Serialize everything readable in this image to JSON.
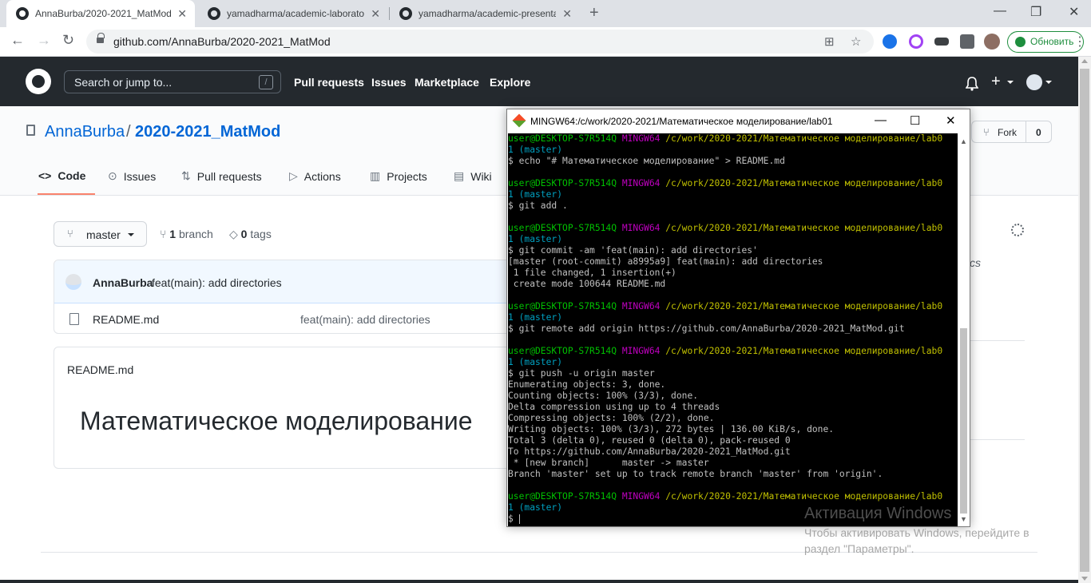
{
  "browser": {
    "tabs": [
      {
        "label": "AnnaBurba/2020-2021_MatMod",
        "active": true
      },
      {
        "label": "yamadharma/academic-laborato",
        "active": false
      },
      {
        "label": "yamadharma/academic-presenta",
        "active": false
      }
    ],
    "url": "github.com/AnnaBurba/2020-2021_MatMod",
    "update_label": "Обновить"
  },
  "github": {
    "search_placeholder": "Search or jump to...",
    "search_shortcut": "/",
    "nav": [
      "Pull requests",
      "Issues",
      "Marketplace",
      "Explore"
    ],
    "repo": {
      "owner": "AnnaBurba",
      "separator": "/",
      "name": "2020-2021_MatMod",
      "fork_label": "Fork",
      "fork_count": "0"
    },
    "tabs": [
      "Code",
      "Issues",
      "Pull requests",
      "Actions",
      "Projects",
      "Wiki"
    ],
    "branch": {
      "current": "master",
      "branch_count": "1",
      "branch_label": "branch",
      "tag_count": "0",
      "tag_label": "tags"
    },
    "commit": {
      "author": "AnnaBurba",
      "message": "feat(main): add directories"
    },
    "files": [
      {
        "name": "README.md",
        "commit": "feat(main): add directories"
      }
    ],
    "readme": {
      "label": "README.md",
      "heading": "Математическое моделирование"
    },
    "about_tail": "cs"
  },
  "terminal": {
    "title": "MINGW64:/c/work/2020-2021/Математическое моделирование/lab01",
    "lines": [
      {
        "parts": [
          [
            "green",
            "user@DESKTOP-S7R514Q "
          ],
          [
            "mag",
            "MINGW64 "
          ],
          [
            "yel",
            "/c/work/2020-2021/Математическое моделирование/lab0"
          ]
        ]
      },
      {
        "parts": [
          [
            "cyan",
            "1 (master)"
          ]
        ]
      },
      {
        "parts": [
          [
            "white",
            "$ echo \"# Математическое моделирование\" > README.md"
          ]
        ]
      },
      {
        "parts": [
          [
            "white",
            ""
          ]
        ]
      },
      {
        "parts": [
          [
            "green",
            "user@DESKTOP-S7R514Q "
          ],
          [
            "mag",
            "MINGW64 "
          ],
          [
            "yel",
            "/c/work/2020-2021/Математическое моделирование/lab0"
          ]
        ]
      },
      {
        "parts": [
          [
            "cyan",
            "1 (master)"
          ]
        ]
      },
      {
        "parts": [
          [
            "white",
            "$ git add ."
          ]
        ]
      },
      {
        "parts": [
          [
            "white",
            ""
          ]
        ]
      },
      {
        "parts": [
          [
            "green",
            "user@DESKTOP-S7R514Q "
          ],
          [
            "mag",
            "MINGW64 "
          ],
          [
            "yel",
            "/c/work/2020-2021/Математическое моделирование/lab0"
          ]
        ]
      },
      {
        "parts": [
          [
            "cyan",
            "1 (master)"
          ]
        ]
      },
      {
        "parts": [
          [
            "white",
            "$ git commit -am 'feat(main): add directories'"
          ]
        ]
      },
      {
        "parts": [
          [
            "white",
            "[master (root-commit) a8995a9] feat(main): add directories"
          ]
        ]
      },
      {
        "parts": [
          [
            "white",
            " 1 file changed, 1 insertion(+)"
          ]
        ]
      },
      {
        "parts": [
          [
            "white",
            " create mode 100644 README.md"
          ]
        ]
      },
      {
        "parts": [
          [
            "white",
            ""
          ]
        ]
      },
      {
        "parts": [
          [
            "green",
            "user@DESKTOP-S7R514Q "
          ],
          [
            "mag",
            "MINGW64 "
          ],
          [
            "yel",
            "/c/work/2020-2021/Математическое моделирование/lab0"
          ]
        ]
      },
      {
        "parts": [
          [
            "cyan",
            "1 (master)"
          ]
        ]
      },
      {
        "parts": [
          [
            "white",
            "$ git remote add origin https://github.com/AnnaBurba/2020-2021_MatMod.git"
          ]
        ]
      },
      {
        "parts": [
          [
            "white",
            ""
          ]
        ]
      },
      {
        "parts": [
          [
            "green",
            "user@DESKTOP-S7R514Q "
          ],
          [
            "mag",
            "MINGW64 "
          ],
          [
            "yel",
            "/c/work/2020-2021/Математическое моделирование/lab0"
          ]
        ]
      },
      {
        "parts": [
          [
            "cyan",
            "1 (master)"
          ]
        ]
      },
      {
        "parts": [
          [
            "white",
            "$ git push -u origin master"
          ]
        ]
      },
      {
        "parts": [
          [
            "white",
            "Enumerating objects: 3, done."
          ]
        ]
      },
      {
        "parts": [
          [
            "white",
            "Counting objects: 100% (3/3), done."
          ]
        ]
      },
      {
        "parts": [
          [
            "white",
            "Delta compression using up to 4 threads"
          ]
        ]
      },
      {
        "parts": [
          [
            "white",
            "Compressing objects: 100% (2/2), done."
          ]
        ]
      },
      {
        "parts": [
          [
            "white",
            "Writing objects: 100% (3/3), 272 bytes | 136.00 KiB/s, done."
          ]
        ]
      },
      {
        "parts": [
          [
            "white",
            "Total 3 (delta 0), reused 0 (delta 0), pack-reused 0"
          ]
        ]
      },
      {
        "parts": [
          [
            "white",
            "To https://github.com/AnnaBurba/2020-2021_MatMod.git"
          ]
        ]
      },
      {
        "parts": [
          [
            "white",
            " * [new branch]      master -> master"
          ]
        ]
      },
      {
        "parts": [
          [
            "white",
            "Branch 'master' set up to track remote branch 'master' from 'origin'."
          ]
        ]
      },
      {
        "parts": [
          [
            "white",
            ""
          ]
        ]
      },
      {
        "parts": [
          [
            "green",
            "user@DESKTOP-S7R514Q "
          ],
          [
            "mag",
            "MINGW64 "
          ],
          [
            "yel",
            "/c/work/2020-2021/Математическое моделирование/lab0"
          ]
        ]
      },
      {
        "parts": [
          [
            "cyan",
            "1 (master)"
          ]
        ]
      },
      {
        "parts": [
          [
            "white",
            "$ "
          ]
        ],
        "cursor": true
      }
    ]
  },
  "watermark": {
    "title": "Активация Windows",
    "line1": "Чтобы активировать Windows, перейдите в",
    "line2": "раздел \"Параметры\"."
  }
}
